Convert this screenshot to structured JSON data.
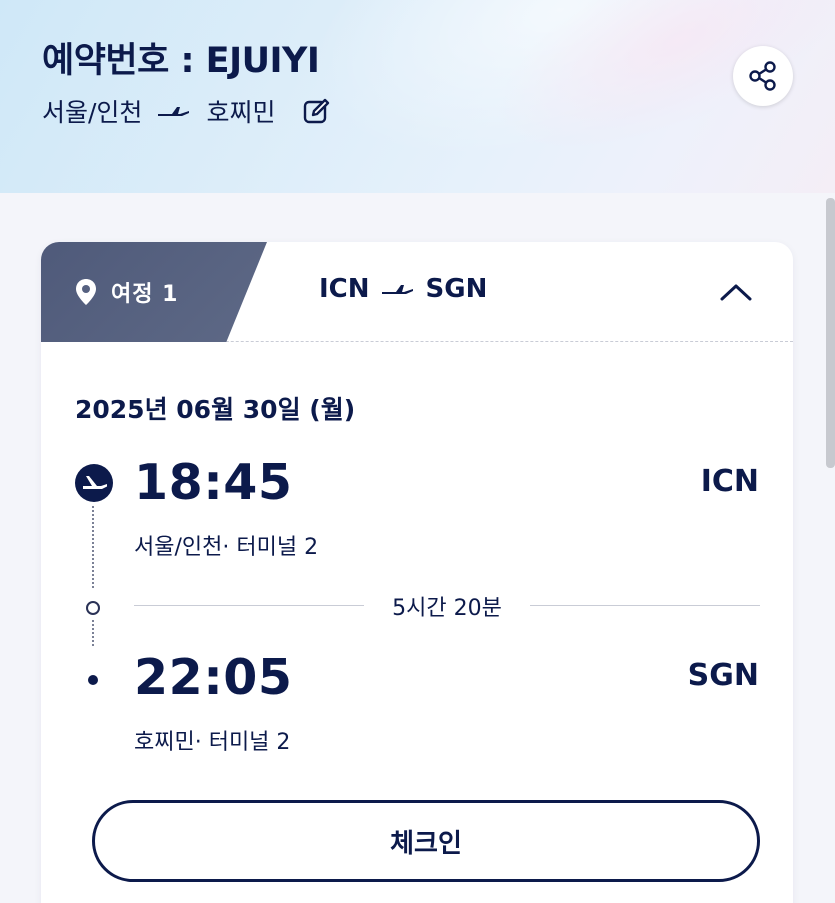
{
  "header": {
    "booking_title": "예약번호 : EJUIYI",
    "origin_city": "서울/인천",
    "destination_city": "호찌민",
    "share_icon": "share-icon",
    "edit_icon": "edit-icon"
  },
  "segment": {
    "tab_label": "여정 1",
    "from_code": "ICN",
    "to_code": "SGN",
    "collapse_icon": "chevron-up-icon",
    "date": "2025년 06월 30일 (월)",
    "departure": {
      "time": "18:45",
      "code": "ICN",
      "place": "서울/인천· 터미널  2"
    },
    "duration": "5시간 20분",
    "arrival": {
      "time": "22:05",
      "code": "SGN",
      "place": "호찌민· 터미널  2"
    },
    "checkin_label": "체크인"
  },
  "colors": {
    "navy": "#0c1a4b",
    "tab_bg": "#566180",
    "page_bg": "#f4f5fa"
  }
}
